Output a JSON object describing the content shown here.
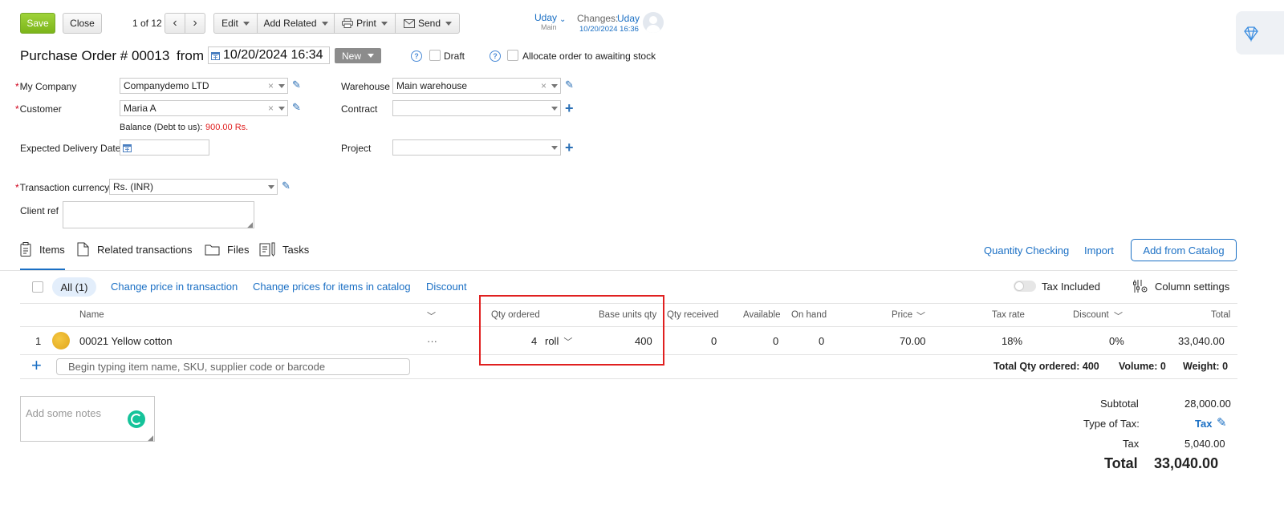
{
  "toolbar": {
    "save": "Save",
    "close": "Close",
    "pager": "1 of 12",
    "edit": "Edit",
    "add_related": "Add Related",
    "print": "Print",
    "send": "Send"
  },
  "user": {
    "name": "Uday",
    "sub": "Main"
  },
  "changes": {
    "label": "Changes:",
    "user": "Uday",
    "time": "10/20/2024 16:36"
  },
  "header": {
    "title": "Purchase Order #",
    "number": "00013",
    "from": "from",
    "datetime": "10/20/2024 16:34",
    "status": "New",
    "draft_label": "Draft",
    "allocate_label": "Allocate order to awaiting stock"
  },
  "form": {
    "my_company": {
      "label": "My Company",
      "value": "Companydemo LTD"
    },
    "customer": {
      "label": "Customer",
      "value": "Maria A"
    },
    "balance": {
      "label": "Balance (Debt to us):",
      "value": "900.00 Rs."
    },
    "expected_delivery": {
      "label": "Expected Delivery Date",
      "value": ""
    },
    "warehouse": {
      "label": "Warehouse",
      "value": "Main warehouse"
    },
    "contract": {
      "label": "Contract",
      "value": ""
    },
    "project": {
      "label": "Project",
      "value": ""
    },
    "currency": {
      "label": "Transaction currency",
      "value": "Rs. (INR)"
    },
    "client_ref": {
      "label": "Client ref",
      "value": ""
    }
  },
  "tabs": {
    "items": "Items",
    "related": "Related transactions",
    "files": "Files",
    "tasks": "Tasks",
    "quantity_checking": "Quantity Checking",
    "import": "Import",
    "add_from_catalog": "Add from Catalog"
  },
  "filters": {
    "all": "All (1)",
    "change_price_transaction": "Change price in transaction",
    "change_price_catalog": "Change prices for items in catalog",
    "discount": "Discount",
    "tax_included": "Tax Included",
    "column_settings": "Column settings"
  },
  "table": {
    "headers": {
      "name": "Name",
      "qty_ordered": "Qty ordered",
      "base_units": "Base units qty",
      "qty_received": "Qty received",
      "available": "Available",
      "on_hand": "On hand",
      "price": "Price",
      "tax_rate": "Tax rate",
      "discount": "Discount",
      "total": "Total"
    },
    "row": {
      "index": "1",
      "name": "00021 Yellow cotton",
      "more": "···",
      "qty": "4",
      "unit": "roll",
      "base_units": "400",
      "received": "0",
      "available": "0",
      "on_hand": "0",
      "price": "70.00",
      "tax_rate": "18%",
      "discount": "0%",
      "total": "33,040.00"
    },
    "add_placeholder": "Begin typing item name, SKU, supplier code or barcode",
    "total_qty": "Total Qty ordered: 400",
    "volume": "Volume: 0",
    "weight": "Weight: 0"
  },
  "notes_placeholder": "Add some notes",
  "summary": {
    "subtotal_label": "Subtotal",
    "subtotal": "28,000.00",
    "tax_type_label": "Type of Tax:",
    "tax_type": "Tax",
    "tax_label": "Tax",
    "tax": "5,040.00",
    "total_label": "Total",
    "total": "33,040.00"
  },
  "colors": {
    "accent": "#1a6fc4",
    "save": "#8dc63f",
    "highlight": "#e02020",
    "negative": "#e02020"
  }
}
